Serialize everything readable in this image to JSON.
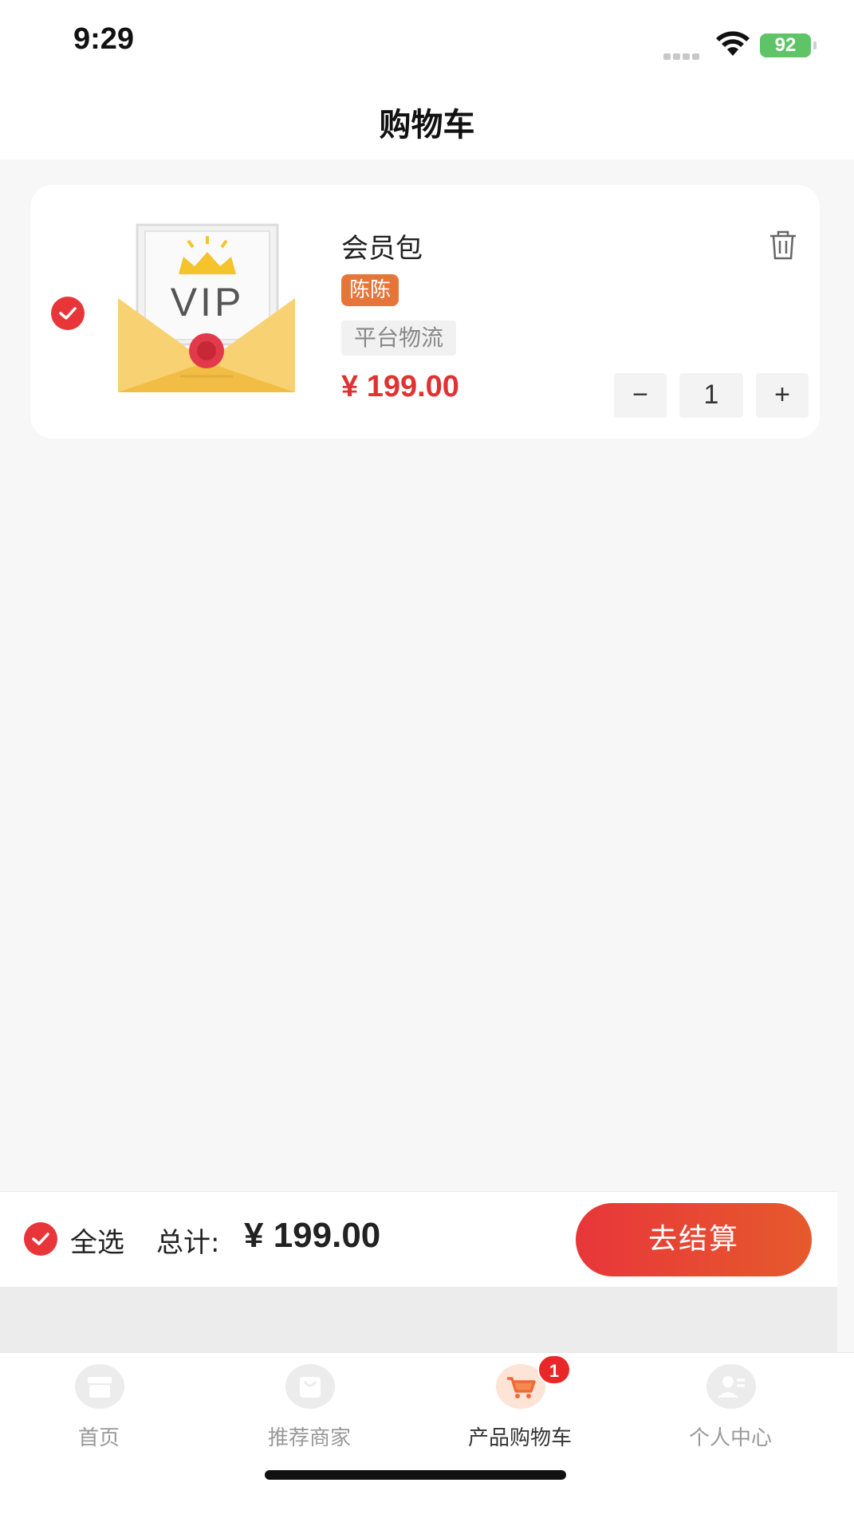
{
  "status_bar": {
    "time": "9:29",
    "battery": "92"
  },
  "header": {
    "title": "购物车"
  },
  "cart_item": {
    "name": "会员包",
    "merchant": "陈陈",
    "shipping": "平台物流",
    "price": "¥ 199.00",
    "quantity": "1",
    "minus_label": "−",
    "plus_label": "+",
    "thumbnail_text": "VIP",
    "checked": true
  },
  "checkout": {
    "select_all_label": "全选",
    "total_label": "总计:",
    "total_value": "¥ 199.00",
    "checkout_label": "去结算"
  },
  "tabs": [
    {
      "label": "首页",
      "icon": "storefront-icon"
    },
    {
      "label": "推荐商家",
      "icon": "shopping-bag-icon"
    },
    {
      "label": "产品购物车",
      "icon": "cart-icon",
      "badge": "1",
      "active": true
    },
    {
      "label": "个人中心",
      "icon": "user-profile-icon"
    }
  ],
  "colors": {
    "accent": "#e8353a",
    "merchant_tag": "#e6753a",
    "price": "#e03232"
  }
}
